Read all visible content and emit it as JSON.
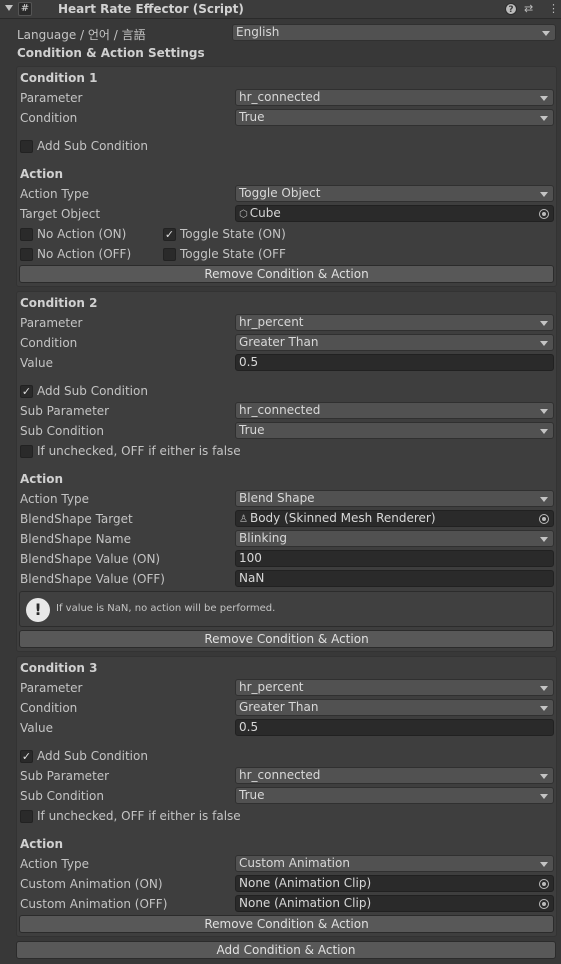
{
  "header": {
    "title": "Heart Rate Effector (Script)",
    "enabled_mark": "#",
    "help": "?",
    "preset": "⇄",
    "more": "⋮"
  },
  "language": {
    "label": "Language / 언어 / 言語",
    "value": "English"
  },
  "section_title": "Condition & Action Settings",
  "common": {
    "parameter": "Parameter",
    "condition": "Condition",
    "value": "Value",
    "add_sub_condition": "Add Sub Condition",
    "sub_parameter": "Sub Parameter",
    "sub_condition": "Sub Condition",
    "if_unchecked": "If unchecked, OFF if either is false",
    "action": "Action",
    "action_type": "Action Type",
    "remove": "Remove Condition & Action",
    "check": "✓"
  },
  "c1": {
    "title": "Condition 1",
    "parameter": "hr_connected",
    "condition": "True",
    "action_type": "Toggle Object",
    "target_label": "Target Object",
    "target": "Cube",
    "no_action_on": "No Action (ON)",
    "toggle_on": "Toggle State (ON)",
    "no_action_off": "No Action (OFF)",
    "toggle_off": "Toggle State (OFF"
  },
  "c2": {
    "title": "Condition 2",
    "parameter": "hr_percent",
    "condition": "Greater Than",
    "value": "0.5",
    "sub_parameter": "hr_connected",
    "sub_condition": "True",
    "action_type": "Blend Shape",
    "bs_target_label": "BlendShape Target",
    "bs_target": "Body (Skinned Mesh Renderer)",
    "bs_name_label": "BlendShape Name",
    "bs_name": "Blinking",
    "bs_on_label": "BlendShape Value (ON)",
    "bs_on": "100",
    "bs_off_label": "BlendShape Value (OFF)",
    "bs_off": "NaN",
    "help_icon": "!",
    "help_text": "If value is NaN, no action will be performed."
  },
  "c3": {
    "title": "Condition 3",
    "parameter": "hr_percent",
    "condition": "Greater Than",
    "value": "0.5",
    "sub_parameter": "hr_connected",
    "sub_condition": "True",
    "action_type": "Custom Animation",
    "anim_on_label": "Custom Animation (ON)",
    "anim_on": "None (Animation Clip)",
    "anim_off_label": "Custom Animation (OFF)",
    "anim_off": "None (Animation Clip)"
  },
  "add_button": "Add Condition & Action",
  "icons": {
    "cube": "⬡",
    "skinned_mesh": "♙"
  }
}
